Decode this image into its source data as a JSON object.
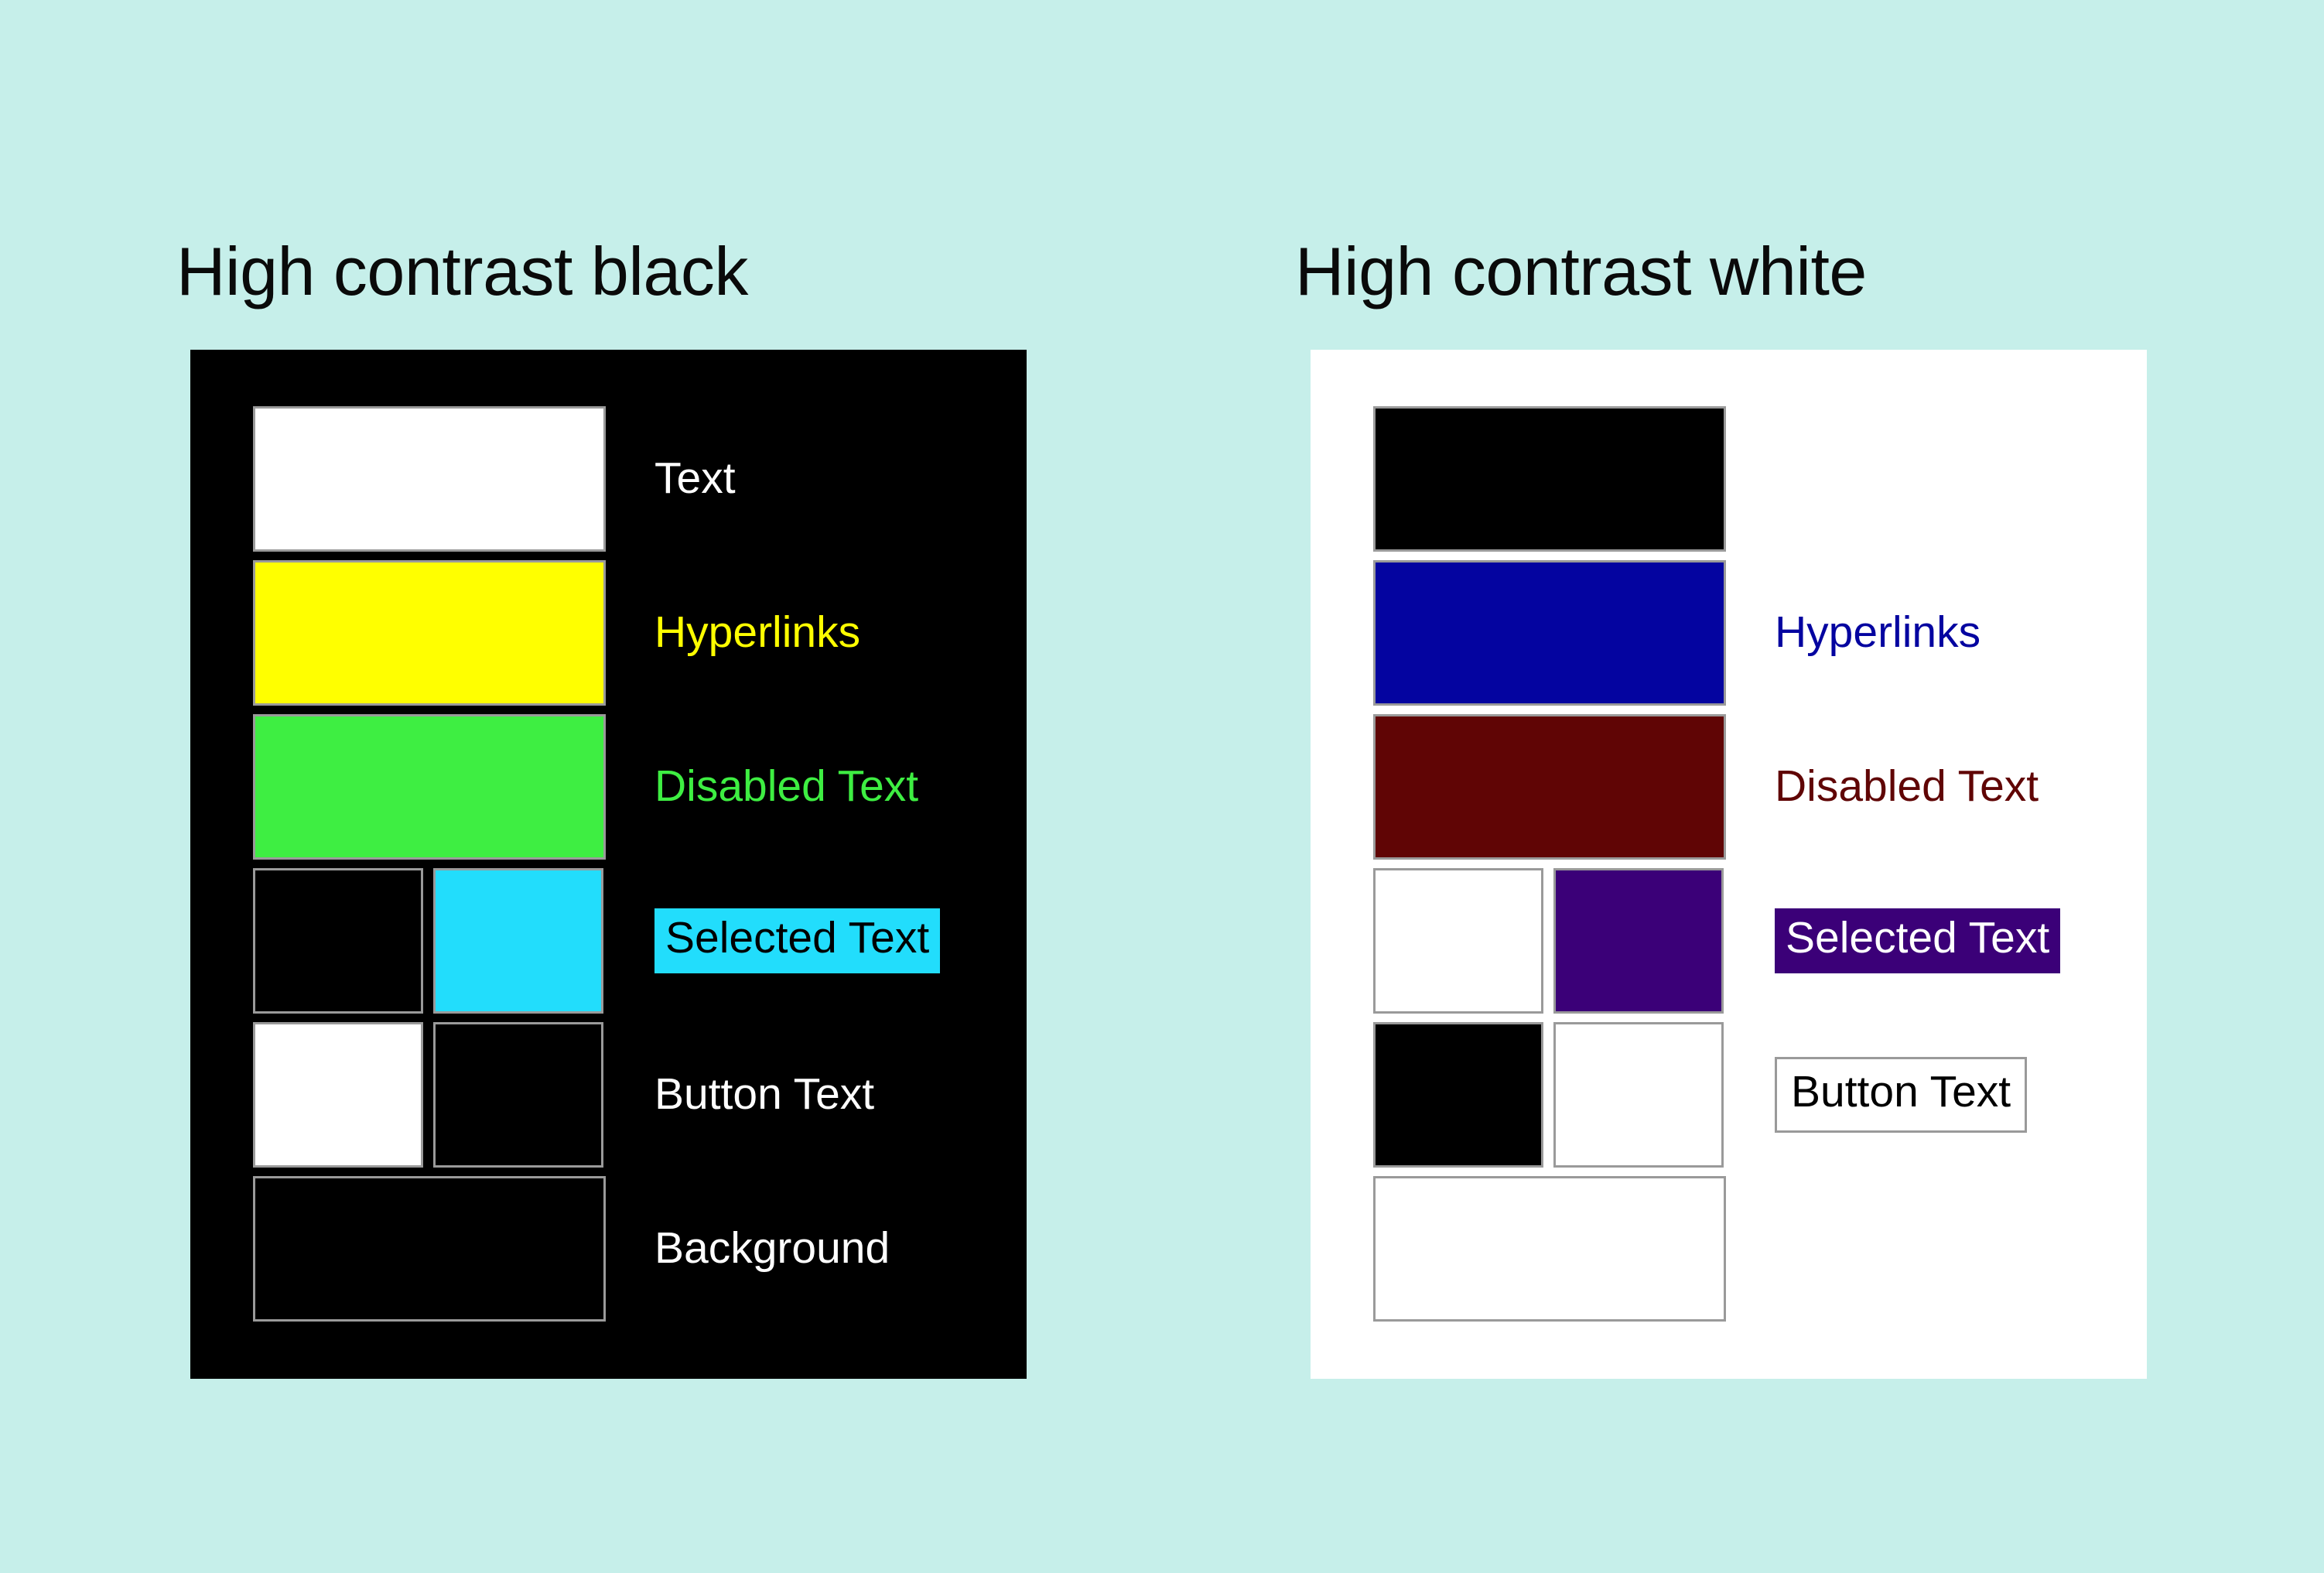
{
  "page": {
    "background_color": "#c6efea",
    "description": "High contrast theme color palette comparison"
  },
  "panels": [
    {
      "id": "high-contrast-black",
      "title": "High contrast black",
      "panel_background": "#000000",
      "swatch_border_color": "#9a9a9a",
      "rows": [
        {
          "name": "text",
          "label": "Text",
          "label_color": "#ffffff",
          "label_background": "none",
          "label_style": "plain",
          "swatches": [
            {
              "color": "#ffffff",
              "span": "full"
            }
          ]
        },
        {
          "name": "hyperlinks",
          "label": "Hyperlinks",
          "label_color": "#ffff00",
          "label_background": "none",
          "label_style": "plain",
          "swatches": [
            {
              "color": "#ffff00",
              "span": "full"
            }
          ]
        },
        {
          "name": "disabled-text",
          "label": "Disabled Text",
          "label_color": "#3eee42",
          "label_background": "none",
          "label_style": "plain",
          "swatches": [
            {
              "color": "#3eee42",
              "span": "full"
            }
          ]
        },
        {
          "name": "selected-text",
          "label": "Selected Text",
          "label_color": "#000000",
          "label_background": "#22ddfc",
          "label_style": "chip",
          "swatches": [
            {
              "color": "#000000",
              "span": "half"
            },
            {
              "color": "#22ddfc",
              "span": "half"
            }
          ]
        },
        {
          "name": "button-text",
          "label": "Button Text",
          "label_color": "#ffffff",
          "label_background": "none",
          "label_style": "plain",
          "swatches": [
            {
              "color": "#ffffff",
              "span": "half"
            },
            {
              "color": "#000000",
              "span": "half"
            }
          ]
        },
        {
          "name": "background",
          "label": "Background",
          "label_color": "#ffffff",
          "label_background": "none",
          "label_style": "plain",
          "swatches": [
            {
              "color": "#000000",
              "span": "full"
            }
          ]
        }
      ]
    },
    {
      "id": "high-contrast-white",
      "title": "High contrast white",
      "panel_background": "#ffffff",
      "swatch_border_color": "#9a9a9a",
      "rows": [
        {
          "name": "text",
          "label": "",
          "label_color": "#000000",
          "label_background": "none",
          "label_style": "none",
          "swatches": [
            {
              "color": "#000000",
              "span": "full"
            }
          ]
        },
        {
          "name": "hyperlinks",
          "label": "Hyperlinks",
          "label_color": "#0404a0",
          "label_background": "none",
          "label_style": "plain",
          "swatches": [
            {
              "color": "#0404a0",
              "span": "full"
            }
          ]
        },
        {
          "name": "disabled-text",
          "label": "Disabled Text",
          "label_color": "#600505",
          "label_background": "none",
          "label_style": "plain",
          "swatches": [
            {
              "color": "#600505",
              "span": "full"
            }
          ]
        },
        {
          "name": "selected-text",
          "label": "Selected Text",
          "label_color": "#ffffff",
          "label_background": "#3b0078",
          "label_style": "chip",
          "swatches": [
            {
              "color": "#ffffff",
              "span": "half"
            },
            {
              "color": "#3b0078",
              "span": "half"
            }
          ]
        },
        {
          "name": "button-text",
          "label": "Button Text",
          "label_color": "#000000",
          "label_background": "#ffffff",
          "label_style": "boxed",
          "swatches": [
            {
              "color": "#000000",
              "span": "half"
            },
            {
              "color": "#ffffff",
              "span": "half"
            }
          ]
        },
        {
          "name": "background",
          "label": "",
          "label_color": "#000000",
          "label_background": "none",
          "label_style": "none",
          "swatches": [
            {
              "color": "#ffffff",
              "span": "full"
            }
          ]
        }
      ]
    }
  ]
}
